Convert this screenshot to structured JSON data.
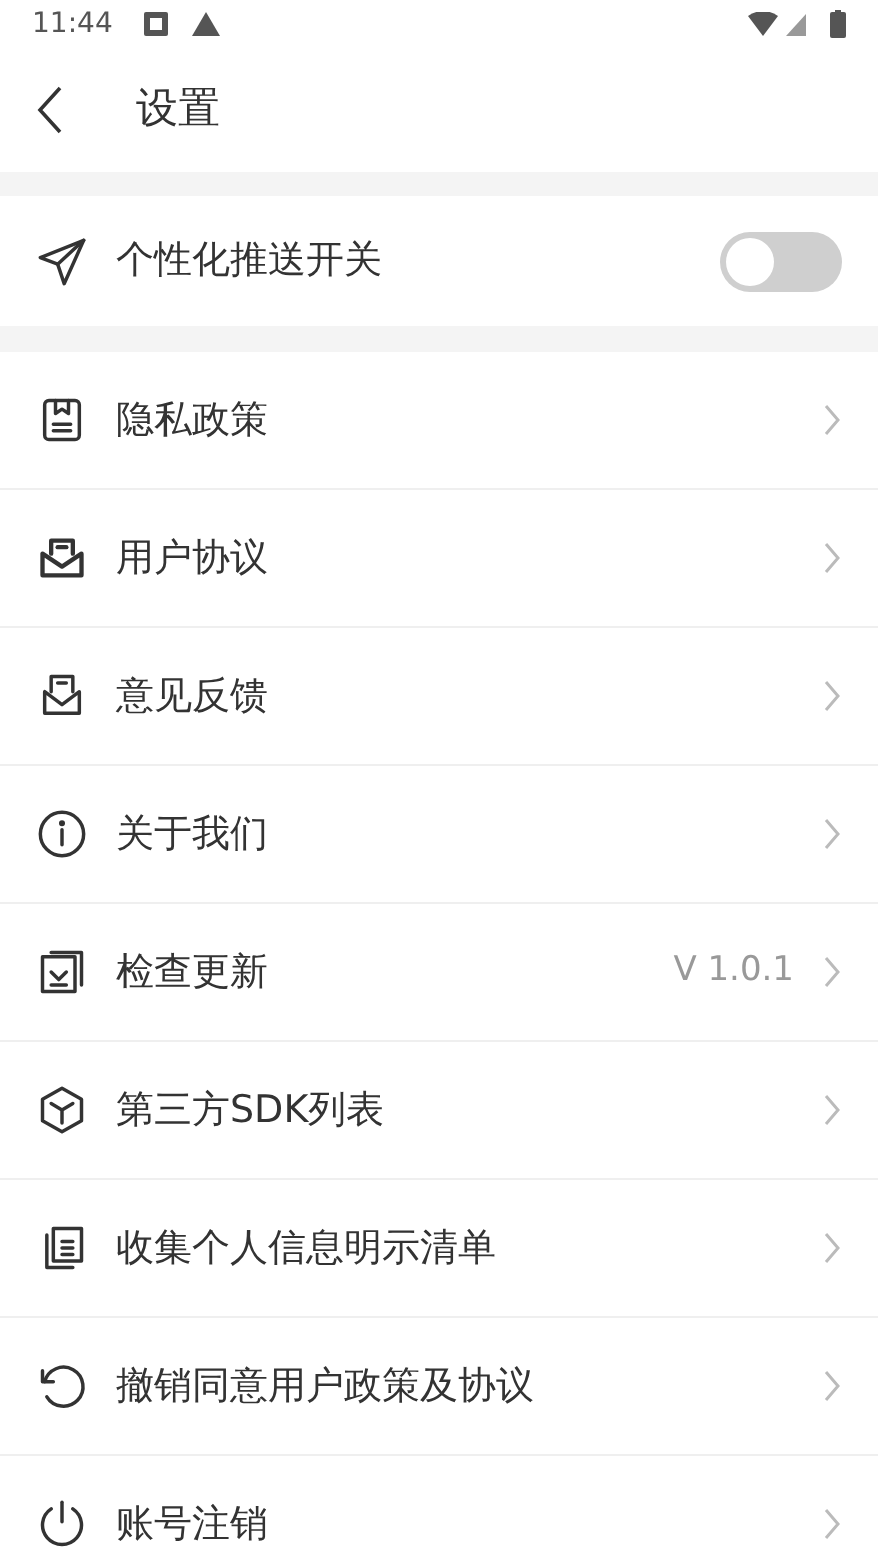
{
  "status_bar": {
    "time": "11:44"
  },
  "header": {
    "title": "设置"
  },
  "push_toggle": {
    "label": "个性化推送开关",
    "on": false
  },
  "items": [
    {
      "label": "隐私政策"
    },
    {
      "label": "用户协议"
    },
    {
      "label": "意见反馈"
    },
    {
      "label": "关于我们"
    },
    {
      "label": "检查更新",
      "value": "V 1.0.1"
    },
    {
      "label": "第三方SDK列表"
    },
    {
      "label": "收集个人信息明示清单"
    },
    {
      "label": "撤销同意用户政策及协议"
    },
    {
      "label": "账号注销"
    }
  ]
}
